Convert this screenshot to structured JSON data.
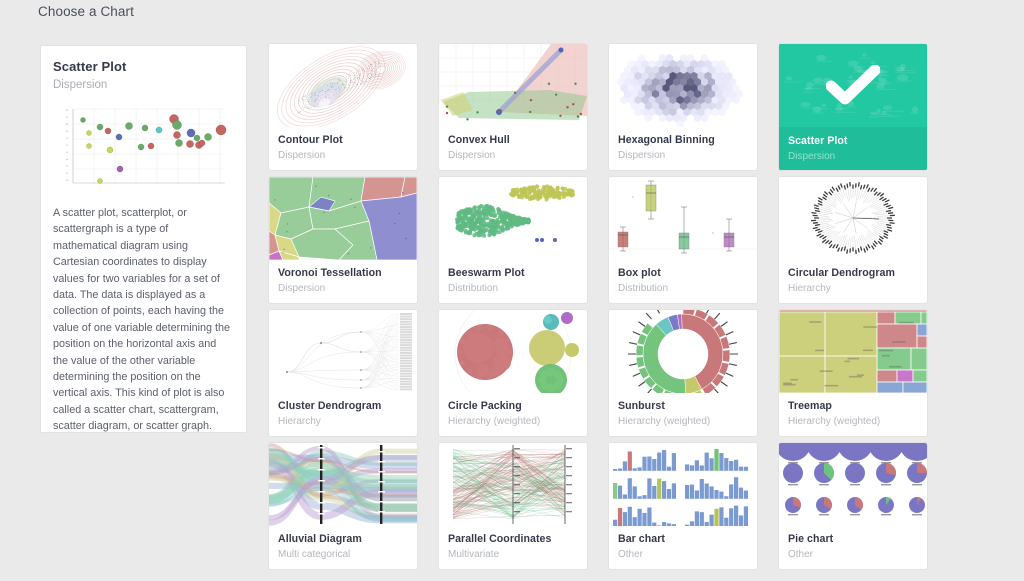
{
  "page": {
    "title": "Choose a Chart"
  },
  "detail": {
    "title": "Scatter Plot",
    "subtitle": "Dispersion",
    "thumb_icon": "scatter-plot-thumbnail",
    "description": "A scatter plot, scatterplot, or scattergraph is a type of mathematical diagram using Cartesian coordinates to display values for two variables for a set of data. The data is displayed as a collection of points, each having the value of one variable determining the position on the horizontal axis and the value of the other variable determining the position on the vertical axis. This kind of plot is also called a scatter chart, scattergram, scatter diagram, or scatter graph."
  },
  "colors": {
    "background": "#eaeaea",
    "card_background": "#ffffff",
    "selected_accent": "#20c49f",
    "selected_footer": "#1fbd99",
    "title_text": "#36394a",
    "subtitle_text": "#b3b7bc"
  },
  "grid": {
    "selected_index": 3,
    "cards": [
      {
        "title": "Contour Plot",
        "subtitle": "Dispersion",
        "thumb": "contour-plot",
        "selected": false
      },
      {
        "title": "Convex Hull",
        "subtitle": "Dispersion",
        "thumb": "convex-hull",
        "selected": false
      },
      {
        "title": "Hexagonal Binning",
        "subtitle": "Dispersion",
        "thumb": "hexagonal-binning",
        "selected": false
      },
      {
        "title": "Scatter Plot",
        "subtitle": "Dispersion",
        "thumb": "scatter-plot",
        "selected": true
      },
      {
        "title": "Voronoi Tessellation",
        "subtitle": "Dispersion",
        "thumb": "voronoi",
        "selected": false
      },
      {
        "title": "Beeswarm Plot",
        "subtitle": "Distribution",
        "thumb": "beeswarm",
        "selected": false
      },
      {
        "title": "Box plot",
        "subtitle": "Distribution",
        "thumb": "box-plot",
        "selected": false
      },
      {
        "title": "Circular Dendrogram",
        "subtitle": "Hierarchy",
        "thumb": "circular-dendrogram",
        "selected": false
      },
      {
        "title": "Cluster Dendrogram",
        "subtitle": "Hierarchy",
        "thumb": "cluster-dendrogram",
        "selected": false
      },
      {
        "title": "Circle Packing",
        "subtitle": "Hierarchy (weighted)",
        "thumb": "circle-packing",
        "selected": false
      },
      {
        "title": "Sunburst",
        "subtitle": "Hierarchy (weighted)",
        "thumb": "sunburst",
        "selected": false
      },
      {
        "title": "Treemap",
        "subtitle": "Hierarchy (weighted)",
        "thumb": "treemap",
        "selected": false
      },
      {
        "title": "Alluvial Diagram",
        "subtitle": "Multi categorical",
        "thumb": "alluvial",
        "selected": false
      },
      {
        "title": "Parallel Coordinates",
        "subtitle": "Multivariate",
        "thumb": "parallel-coordinates",
        "selected": false
      },
      {
        "title": "Bar chart",
        "subtitle": "Other",
        "thumb": "bar-chart",
        "selected": false
      },
      {
        "title": "Pie chart",
        "subtitle": "Other",
        "thumb": "pie-chart",
        "selected": false
      }
    ]
  },
  "chart_data": {
    "type": "scatter",
    "title": "Scatter Plot",
    "subtitle": "Dispersion",
    "xlabel": "",
    "ylabel": "",
    "grid": true,
    "legend": "none",
    "xlim": [
      0,
      100
    ],
    "ylim": [
      0,
      100
    ],
    "series": [
      {
        "name": "green",
        "color": "#5aa35a",
        "x": [
          8,
          22,
          38,
          48,
          58,
          72,
          80,
          86,
          92
        ],
        "y": [
          82,
          74,
          72,
          70,
          52,
          78,
          62,
          60,
          64
        ],
        "r": [
          2.5,
          3,
          3.5,
          3,
          3,
          4.5,
          3.5,
          3.5,
          4
        ]
      },
      {
        "name": "red",
        "color": "#c0564f",
        "x": [
          19,
          50,
          68,
          76,
          82,
          85,
          88,
          96
        ],
        "y": [
          73,
          50,
          88,
          66,
          57,
          56,
          55,
          68
        ],
        "r": [
          3,
          3,
          5,
          4,
          3.5,
          4,
          3.5,
          5
        ]
      },
      {
        "name": "blue",
        "color": "#4a5fb0",
        "x": [
          27,
          78
        ],
        "y": [
          58,
          66
        ],
        "r": [
          3,
          4.5
        ]
      },
      {
        "name": "purple",
        "color": "#9c4fa0",
        "x": [
          29
        ],
        "y": [
          17
        ],
        "r": [
          3
        ]
      },
      {
        "name": "yellow",
        "color": "#c9c94a",
        "x": [
          12,
          24,
          22
        ],
        "y": [
          48,
          42,
          7
        ],
        "r": [
          2.5,
          3,
          2.5
        ]
      },
      {
        "name": "cyan",
        "color": "#4fc2bd",
        "x": [
          60
        ],
        "y": [
          68
        ],
        "r": [
          3
        ]
      }
    ]
  }
}
